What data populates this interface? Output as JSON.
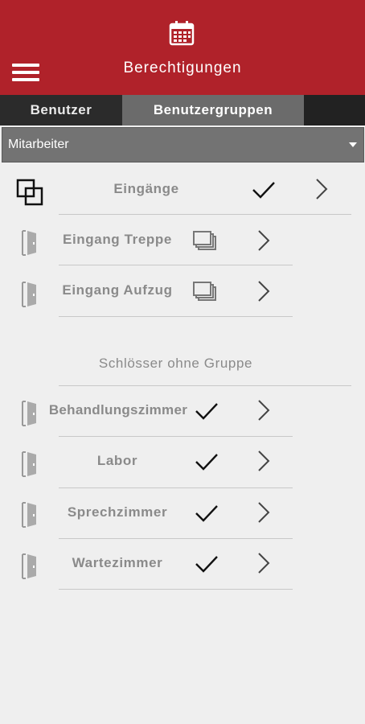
{
  "header": {
    "title": "Berechtigungen",
    "calendar_icon": "calendar-icon",
    "menu_icon": "hamburger-menu-icon",
    "background_color": "#b0222a"
  },
  "tabs": [
    {
      "label": "Benutzer",
      "active": false
    },
    {
      "label": "Benutzergruppen",
      "active": true
    }
  ],
  "group_selector": {
    "selected": "Mitarbeiter"
  },
  "group": {
    "label": "Eingänge",
    "icon": "lock-group-icon",
    "checked": true,
    "items": [
      {
        "label": "Eingang Treppe",
        "icon": "door-icon",
        "action_icon": "multi-copy-icon"
      },
      {
        "label": "Eingang Aufzug",
        "icon": "door-icon",
        "action_icon": "multi-copy-icon"
      }
    ]
  },
  "ungrouped": {
    "heading": "Schlösser ohne Gruppe",
    "items": [
      {
        "label": "Behandlungszimmer",
        "icon": "door-icon",
        "checked": true
      },
      {
        "label": "Labor",
        "icon": "door-icon",
        "checked": true
      },
      {
        "label": "Sprechzimmer",
        "icon": "door-icon",
        "checked": true
      },
      {
        "label": "Wartezimmer",
        "icon": "door-icon",
        "checked": true
      }
    ]
  }
}
